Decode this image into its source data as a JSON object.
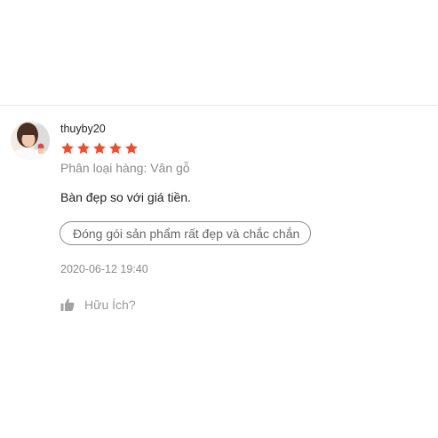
{
  "review": {
    "username": "thuyby20",
    "rating": 5,
    "rating_max": 5,
    "star_color": "#ee4d2d",
    "variation": "Phân loại hàng: Vân gỗ",
    "comment": "Bàn đẹp so với giá tiền.",
    "tags": [
      "Đóng gói sản phẩm rất đẹp và chắc chắn"
    ],
    "timestamp": "2020-06-12 19:40",
    "helpful_label": "Hữu Ích?"
  },
  "icons": {
    "avatar": "user-avatar",
    "star": "star-icon",
    "helpful": "thumbs-up-icon"
  }
}
